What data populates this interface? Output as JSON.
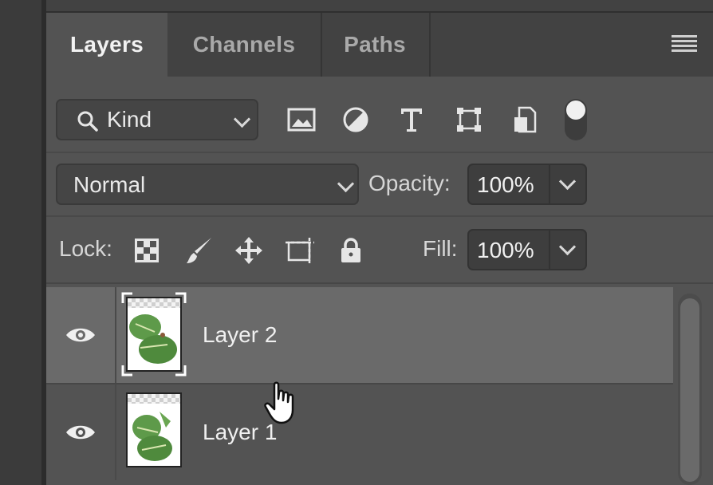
{
  "tabs": [
    {
      "label": "Layers",
      "active": true
    },
    {
      "label": "Channels",
      "active": false
    },
    {
      "label": "Paths",
      "active": false
    }
  ],
  "filter": {
    "kind_label": "Kind",
    "buttons": [
      "image-filter-icon",
      "adjustment-filter-icon",
      "type-filter-icon",
      "shape-filter-icon",
      "smart-object-filter-icon"
    ]
  },
  "blend": {
    "mode": "Normal"
  },
  "opacity": {
    "label": "Opacity:",
    "value": "100%"
  },
  "lock": {
    "label": "Lock:",
    "buttons": [
      "lock-transparent-pixels-icon",
      "lock-image-pixels-icon",
      "lock-position-icon",
      "lock-artboard-icon",
      "lock-all-icon"
    ]
  },
  "fill": {
    "label": "Fill:",
    "value": "100%"
  },
  "layers": [
    {
      "name": "Layer 2",
      "visible": true,
      "selected": true
    },
    {
      "name": "Layer 1",
      "visible": true,
      "selected": false
    }
  ],
  "colors": {
    "panel": "#535353",
    "selected_row": "#6a6a6a",
    "tabbar": "#424242"
  }
}
